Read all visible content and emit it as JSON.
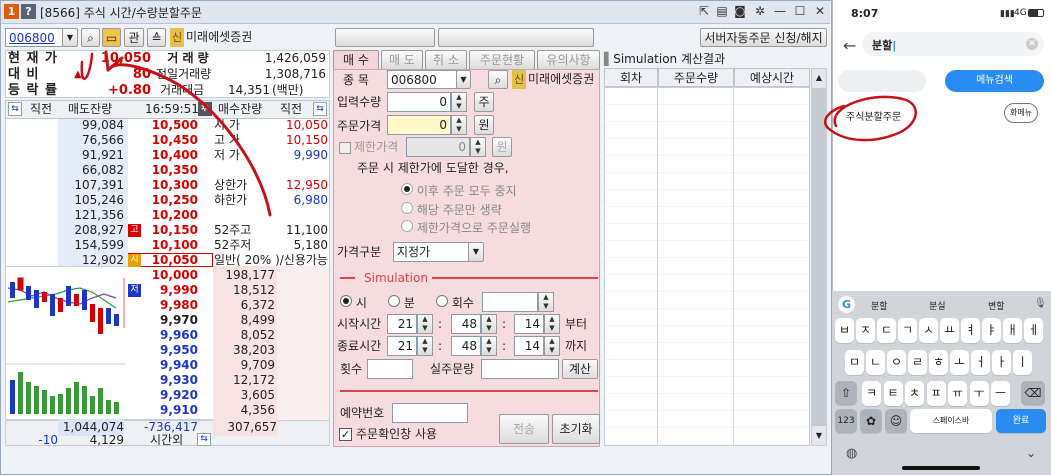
{
  "window": {
    "title": "[8566] 주식 시간/수량분할주문",
    "sysicon1": "1",
    "sysicon2": "?",
    "btn_min": "—",
    "btn_max": "☐",
    "btn_close": "✕"
  },
  "toolbar": {
    "code": "006800",
    "kwan": "관",
    "shin": "신",
    "stock_name": "미래에셋증권",
    "server_btn": "서버자동주문 신청/해지"
  },
  "quote": {
    "labels": [
      "현 재 가",
      "대 비",
      "등 락 률"
    ],
    "price": "10,050",
    "change": "80",
    "rate": "+0.80",
    "arrow": "▲",
    "stat_labels": [
      "거 래 량",
      "전일거래량",
      "거래대금"
    ],
    "volume": "1,426,059",
    "prev_volume": "1,308,716",
    "amount": "14,351",
    "amount_unit": "(백만)"
  },
  "orderbook": {
    "header": {
      "left": "직전",
      "sell_rem": "매도잔량",
      "time": "16:59:51",
      "buy_rem": "매수잔량",
      "right": "직전"
    },
    "asks": [
      {
        "qty": "99,084",
        "price": "10,500",
        "info_label": "시 가",
        "info_val": "10,050"
      },
      {
        "qty": "76,566",
        "price": "10,450",
        "info_label": "고 가",
        "info_val": "10,150"
      },
      {
        "qty": "91,921",
        "price": "10,400",
        "info_label": "저 가",
        "info_val": "9,990"
      },
      {
        "qty": "66,082",
        "price": "10,350",
        "info_label": "",
        "info_val": ""
      },
      {
        "qty": "107,391",
        "price": "10,300",
        "info_label": "상한가",
        "info_val": "12,950"
      },
      {
        "qty": "105,246",
        "price": "10,250",
        "info_label": "하한가",
        "info_val": "6,980"
      },
      {
        "qty": "121,356",
        "price": "10,200",
        "info_label": "",
        "info_val": ""
      },
      {
        "qty": "208,927",
        "price": "10,150",
        "tag": "고",
        "info_label": "52주고",
        "info_val": "11,100"
      },
      {
        "qty": "154,599",
        "price": "10,100",
        "info_label": "52주저",
        "info_val": "5,180"
      },
      {
        "qty": "12,902",
        "price": "10,050",
        "tag": "시",
        "info_label": "일반( 20% )/신용가능",
        "info_val": ""
      }
    ],
    "bids": [
      {
        "price": "10,000",
        "qty": "198,177"
      },
      {
        "price": "9,990",
        "qty": "18,512",
        "tag": "저"
      },
      {
        "price": "9,980",
        "qty": "6,372"
      },
      {
        "price": "9,970",
        "qty": "8,499"
      },
      {
        "price": "9,960",
        "qty": "8,052"
      },
      {
        "price": "9,950",
        "qty": "38,203"
      },
      {
        "price": "9,940",
        "qty": "9,709"
      },
      {
        "price": "9,930",
        "qty": "12,172"
      },
      {
        "price": "9,920",
        "qty": "3,605"
      },
      {
        "price": "9,910",
        "qty": "4,356"
      }
    ],
    "footer": {
      "sell_total": "1,044,074",
      "diff": "-736,417",
      "buy_total": "307,657",
      "left2": "-10",
      "vol2": "4,129",
      "after": "시간외"
    }
  },
  "order": {
    "tabs": [
      "매 수",
      "매 도",
      "취 소",
      "주문현황",
      "유의사항"
    ],
    "code_label": "종 목",
    "code": "006800",
    "shin": "신",
    "stock_name": "미래에셋증권",
    "qty_label": "입력수량",
    "qty": "0",
    "qty_unit": "주",
    "price_label": "주문가격",
    "price": "0",
    "price_unit": "원",
    "limit_label": "제한가격",
    "limit": "0",
    "limit_unit": "원",
    "reach_text": "주문 시 제한가에 도달한 경우,",
    "opt1": "이후 주문 모두 중지",
    "opt2": "해당 주문만 생략",
    "opt3": "제한가격으로 주문실행",
    "type_label": "가격구분",
    "type_value": "지정가",
    "sim_title": "Simulation",
    "unit_hour": "시",
    "unit_min": "분",
    "unit_count": "회수",
    "start_label": "시작시간",
    "start_h": "21",
    "start_m": "48",
    "start_s": "14",
    "start_suffix": "부터",
    "end_label": "종료시간",
    "end_h": "21",
    "end_m": "48",
    "end_s": "14",
    "end_suffix": "까지",
    "count_label": "횟수",
    "real_qty_label": "실주문량",
    "calc_btn": "계산",
    "reserve_label": "예약번호",
    "confirm_label": "주문확인창 사용",
    "send_btn": "전송",
    "reset_btn": "초기화"
  },
  "simulation": {
    "title": "Simulation 계산결과",
    "cols": [
      "회차",
      "주문수량",
      "예상시간"
    ]
  },
  "phone": {
    "time": "8:07",
    "status": "4G",
    "search_value": "분할",
    "chip_btn": "메뉴검색",
    "result": "주식분할주문",
    "result_btn": "화메뉴",
    "suggestions": [
      "분할",
      "분실",
      "변할"
    ],
    "rows": [
      [
        "ㅂ",
        "ㅈ",
        "ㄷ",
        "ㄱ",
        "ㅅ",
        "ㅛ",
        "ㅕ",
        "ㅑ",
        "ㅐ",
        "ㅔ"
      ],
      [
        "ㅁ",
        "ㄴ",
        "ㅇ",
        "ㄹ",
        "ㅎ",
        "ㅗ",
        "ㅓ",
        "ㅏ",
        "ㅣ"
      ],
      [
        "ㅋ",
        "ㅌ",
        "ㅊ",
        "ㅍ",
        "ㅠ",
        "ㅜ",
        "ㅡ"
      ]
    ],
    "key_123": "123",
    "space": "스페이스바",
    "enter": "완료"
  },
  "colors": {
    "red": "#d40000",
    "blue": "#1b37c8",
    "annotation": "#c8101a",
    "accent": "#2a8cf0"
  }
}
